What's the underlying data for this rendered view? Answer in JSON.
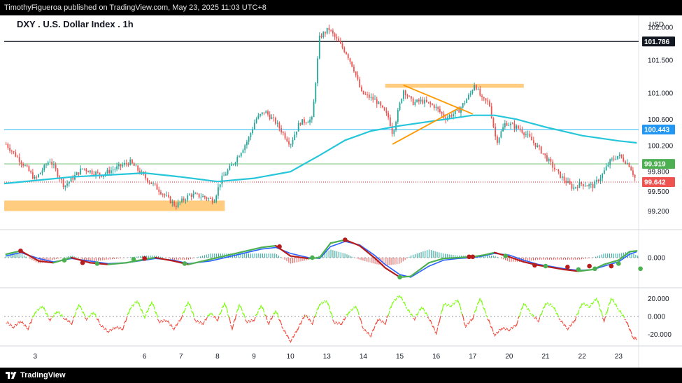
{
  "header": {
    "publisher_text": "TimothyFigueroa published on TradingView.com, May 23, 2025 11:03 UTC+8"
  },
  "chart": {
    "title": "DXY . U.S. Dollar Index . 1h",
    "currency": "USD"
  },
  "footer": {
    "brand": "TradingView"
  },
  "colors": {
    "up": "#26a69a",
    "down": "#ef5350",
    "ema": "#26c6da",
    "black_line": "#131722",
    "blue_line": "#4fc3f7",
    "green_line": "#81c784",
    "red_dotted": "#ef5350",
    "orange_box": "#ffcc80",
    "orange_line": "#ff9800",
    "macd_blue": "#2962ff",
    "macd_signal": "#b71c1c",
    "macd_fast": "#4caf50",
    "rsi_green": "#76ff03",
    "rsi_red": "#f44336"
  },
  "chart_data": {
    "type": "candlestick",
    "symbol": "DXY",
    "name": "U.S. Dollar Index",
    "interval": "1h",
    "x_ticks": [
      "3",
      "6",
      "7",
      "8",
      "9",
      "10",
      "13",
      "14",
      "15",
      "16",
      "17",
      "20",
      "21",
      "22",
      "23"
    ],
    "x_tick_pos": [
      3,
      6,
      7,
      8,
      9,
      10,
      11,
      12,
      13,
      14,
      15,
      16,
      17,
      18,
      19
    ],
    "x_range": [
      2.15,
      19.55
    ],
    "y_ticks": [
      102.0,
      101.5,
      101.0,
      100.6,
      100.2,
      99.8,
      99.5,
      99.2
    ],
    "y_tick_labels": [
      "102.000",
      "101.500",
      "101.000",
      "100.600",
      "100.200",
      "99.800",
      "99.500",
      "99.200"
    ],
    "ylim": [
      98.98,
      102.12
    ],
    "price_labels": [
      {
        "value": 101.786,
        "label": "101.786",
        "color": "#131722"
      },
      {
        "value": 100.443,
        "label": "100.443",
        "color": "#2196f3"
      },
      {
        "value": 99.919,
        "label": "99.919",
        "color": "#4caf50"
      },
      {
        "value": 99.642,
        "label": "99.642",
        "color": "#ef5350"
      }
    ],
    "horizontal_lines": [
      {
        "value": 101.786,
        "color": "#131722",
        "style": "solid"
      },
      {
        "value": 100.443,
        "color": "#4fc3f7",
        "style": "solid"
      },
      {
        "value": 99.919,
        "color": "#81c784",
        "style": "solid"
      },
      {
        "value": 99.642,
        "color": "#ef5350",
        "style": "dotted"
      }
    ],
    "zones": [
      {
        "x": [
          2.15,
          8.2
        ],
        "y": [
          99.2,
          99.36
        ],
        "color": "#ffcc80"
      },
      {
        "x": [
          12.6,
          16.4
        ],
        "y": [
          101.08,
          101.14
        ],
        "color": "#ffcc80"
      }
    ],
    "trendlines": [
      {
        "points": [
          [
            13.1,
            101.12
          ],
          [
            15.0,
            100.68
          ]
        ],
        "color": "#ff9800"
      },
      {
        "points": [
          [
            12.8,
            100.22
          ],
          [
            14.65,
            100.78
          ]
        ],
        "color": "#ff9800"
      }
    ],
    "price_path": [
      [
        2.2,
        100.22
      ],
      [
        2.7,
        99.9
      ],
      [
        3.0,
        99.68
      ],
      [
        3.4,
        99.98
      ],
      [
        3.8,
        99.58
      ],
      [
        4.3,
        99.85
      ],
      [
        4.8,
        99.75
      ],
      [
        5.6,
        99.95
      ],
      [
        6.0,
        99.72
      ],
      [
        6.4,
        99.52
      ],
      [
        6.85,
        99.28
      ],
      [
        7.25,
        99.45
      ],
      [
        7.6,
        99.42
      ],
      [
        7.9,
        99.36
      ],
      [
        8.1,
        99.68
      ],
      [
        8.5,
        99.98
      ],
      [
        8.85,
        100.3
      ],
      [
        9.05,
        100.6
      ],
      [
        9.3,
        100.72
      ],
      [
        9.6,
        100.55
      ],
      [
        10.0,
        100.22
      ],
      [
        10.25,
        100.55
      ],
      [
        10.6,
        100.6
      ],
      [
        10.8,
        101.85
      ],
      [
        11.05,
        101.98
      ],
      [
        11.35,
        101.75
      ],
      [
        11.55,
        101.6
      ],
      [
        11.75,
        101.35
      ],
      [
        11.95,
        101.0
      ],
      [
        12.35,
        100.88
      ],
      [
        12.7,
        100.62
      ],
      [
        12.8,
        100.38
      ],
      [
        13.1,
        101.05
      ],
      [
        13.35,
        100.85
      ],
      [
        13.6,
        100.88
      ],
      [
        13.95,
        100.8
      ],
      [
        14.25,
        100.62
      ],
      [
        14.6,
        100.72
      ],
      [
        14.95,
        101.0
      ],
      [
        15.05,
        101.15
      ],
      [
        15.25,
        100.9
      ],
      [
        15.45,
        100.85
      ],
      [
        15.65,
        100.25
      ],
      [
        15.9,
        100.55
      ],
      [
        16.3,
        100.45
      ],
      [
        16.5,
        100.35
      ],
      [
        16.9,
        100.1
      ],
      [
        17.3,
        99.8
      ],
      [
        17.5,
        99.68
      ],
      [
        17.75,
        99.55
      ],
      [
        17.95,
        99.62
      ],
      [
        18.3,
        99.58
      ],
      [
        18.55,
        99.75
      ],
      [
        18.75,
        99.95
      ],
      [
        19.0,
        100.05
      ],
      [
        19.3,
        99.9
      ],
      [
        19.5,
        99.64
      ]
    ],
    "ema_line": [
      [
        2.15,
        99.62
      ],
      [
        4.0,
        99.72
      ],
      [
        6.0,
        99.78
      ],
      [
        7.0,
        99.72
      ],
      [
        8.0,
        99.65
      ],
      [
        9.0,
        99.7
      ],
      [
        10.0,
        99.8
      ],
      [
        10.8,
        100.05
      ],
      [
        11.5,
        100.28
      ],
      [
        12.2,
        100.42
      ],
      [
        13.0,
        100.5
      ],
      [
        14.0,
        100.58
      ],
      [
        15.0,
        100.66
      ],
      [
        15.6,
        100.66
      ],
      [
        16.2,
        100.6
      ],
      [
        17.0,
        100.48
      ],
      [
        18.0,
        100.35
      ],
      [
        19.0,
        100.27
      ],
      [
        19.5,
        100.24
      ]
    ],
    "macd": {
      "zero_label": "0.000",
      "ylim": [
        -0.33,
        0.28
      ],
      "fast": [
        [
          2.2,
          0.04
        ],
        [
          2.6,
          0.08
        ],
        [
          3.1,
          -0.04
        ],
        [
          3.5,
          -0.06
        ],
        [
          4.0,
          0.0
        ],
        [
          4.5,
          -0.06
        ],
        [
          5.0,
          -0.08
        ],
        [
          5.5,
          -0.06
        ],
        [
          6.0,
          -0.02
        ],
        [
          6.3,
          0.0
        ],
        [
          6.8,
          -0.04
        ],
        [
          7.2,
          -0.08
        ],
        [
          7.8,
          -0.02
        ],
        [
          8.3,
          0.03
        ],
        [
          8.8,
          0.08
        ],
        [
          9.2,
          0.12
        ],
        [
          9.6,
          0.14
        ],
        [
          10.0,
          0.02
        ],
        [
          10.5,
          -0.01
        ],
        [
          10.8,
          0.0
        ],
        [
          11.1,
          0.17
        ],
        [
          11.5,
          0.21
        ],
        [
          11.9,
          0.14
        ],
        [
          12.3,
          0.0
        ],
        [
          12.6,
          -0.12
        ],
        [
          13.0,
          -0.23
        ],
        [
          13.3,
          -0.22
        ],
        [
          13.8,
          -0.06
        ],
        [
          14.2,
          -0.01
        ],
        [
          14.6,
          0.0
        ],
        [
          15.0,
          0.01
        ],
        [
          15.3,
          0.03
        ],
        [
          15.6,
          0.06
        ],
        [
          16.0,
          0.01
        ],
        [
          16.4,
          -0.05
        ],
        [
          16.8,
          -0.09
        ],
        [
          17.1,
          -0.11
        ],
        [
          17.5,
          -0.14
        ],
        [
          17.9,
          -0.16
        ],
        [
          18.3,
          -0.14
        ],
        [
          18.6,
          -0.08
        ],
        [
          19.0,
          -0.03
        ],
        [
          19.3,
          0.07
        ],
        [
          19.5,
          0.08
        ]
      ],
      "slow": [
        [
          2.2,
          0.02
        ],
        [
          2.6,
          0.06
        ],
        [
          3.1,
          -0.01
        ],
        [
          3.5,
          -0.05
        ],
        [
          4.0,
          -0.01
        ],
        [
          4.5,
          -0.04
        ],
        [
          5.0,
          -0.07
        ],
        [
          5.5,
          -0.06
        ],
        [
          6.0,
          -0.03
        ],
        [
          6.3,
          -0.01
        ],
        [
          6.8,
          -0.03
        ],
        [
          7.2,
          -0.07
        ],
        [
          7.8,
          -0.04
        ],
        [
          8.3,
          0.01
        ],
        [
          8.8,
          0.06
        ],
        [
          9.2,
          0.1
        ],
        [
          9.6,
          0.12
        ],
        [
          10.0,
          0.05
        ],
        [
          10.5,
          0.0
        ],
        [
          10.8,
          -0.01
        ],
        [
          11.1,
          0.13
        ],
        [
          11.5,
          0.19
        ],
        [
          11.9,
          0.15
        ],
        [
          12.3,
          0.03
        ],
        [
          12.6,
          -0.08
        ],
        [
          13.0,
          -0.2
        ],
        [
          13.3,
          -0.23
        ],
        [
          13.8,
          -0.1
        ],
        [
          14.2,
          -0.03
        ],
        [
          14.6,
          -0.01
        ],
        [
          15.0,
          0.0
        ],
        [
          15.3,
          0.02
        ],
        [
          15.6,
          0.05
        ],
        [
          16.0,
          0.03
        ],
        [
          16.4,
          -0.03
        ],
        [
          16.8,
          -0.08
        ],
        [
          17.1,
          -0.1
        ],
        [
          17.5,
          -0.13
        ],
        [
          17.9,
          -0.15
        ],
        [
          18.3,
          -0.14
        ],
        [
          18.6,
          -0.1
        ],
        [
          19.0,
          -0.05
        ],
        [
          19.3,
          0.04
        ],
        [
          19.5,
          0.07
        ]
      ],
      "signal_dots": [
        {
          "x": 2.6,
          "v": 0.08,
          "c": "#b71c1c"
        },
        {
          "x": 3.8,
          "v": -0.03,
          "c": "#4caf50"
        },
        {
          "x": 4.3,
          "v": -0.06,
          "c": "#b71c1c"
        },
        {
          "x": 4.7,
          "v": -0.07,
          "c": "#4caf50"
        },
        {
          "x": 5.7,
          "v": -0.02,
          "c": "#4caf50"
        },
        {
          "x": 6.0,
          "v": -0.01,
          "c": "#b71c1c"
        },
        {
          "x": 7.1,
          "v": -0.07,
          "c": "#4caf50"
        },
        {
          "x": 9.7,
          "v": 0.13,
          "c": "#b71c1c"
        },
        {
          "x": 10.6,
          "v": 0.0,
          "c": "#4caf50"
        },
        {
          "x": 11.5,
          "v": 0.21,
          "c": "#b71c1c"
        },
        {
          "x": 13.0,
          "v": -0.23,
          "c": "#4caf50"
        },
        {
          "x": 14.9,
          "v": 0.01,
          "c": "#b71c1c"
        },
        {
          "x": 15.0,
          "v": 0.01,
          "c": "#b71c1c"
        },
        {
          "x": 15.9,
          "v": 0.02,
          "c": "#4caf50"
        },
        {
          "x": 16.7,
          "v": -0.09,
          "c": "#b71c1c"
        },
        {
          "x": 17.0,
          "v": -0.1,
          "c": "#4caf50"
        },
        {
          "x": 17.6,
          "v": -0.11,
          "c": "#b71c1c"
        },
        {
          "x": 17.9,
          "v": -0.14,
          "c": "#4caf50"
        },
        {
          "x": 18.2,
          "v": -0.1,
          "c": "#b71c1c"
        },
        {
          "x": 18.35,
          "v": -0.13,
          "c": "#4caf50"
        },
        {
          "x": 18.8,
          "v": -0.1,
          "c": "#b71c1c"
        },
        {
          "x": 19.0,
          "v": -0.07,
          "c": "#4caf50"
        },
        {
          "x": 19.6,
          "v": -0.13,
          "c": "#4caf50"
        }
      ]
    },
    "oscillator": {
      "ylim": [
        -30,
        30
      ],
      "ticks": [
        20.0,
        0.0,
        -20.0
      ],
      "tick_labels": [
        "20.000",
        "0.000",
        "-20.000"
      ],
      "values": [
        [
          2.2,
          -6
        ],
        [
          2.4,
          -12
        ],
        [
          2.6,
          -5
        ],
        [
          2.8,
          -14
        ],
        [
          3.0,
          5
        ],
        [
          3.2,
          12
        ],
        [
          3.4,
          -4
        ],
        [
          3.6,
          6
        ],
        [
          3.8,
          -2
        ],
        [
          4.0,
          -8
        ],
        [
          4.2,
          14
        ],
        [
          4.4,
          -3
        ],
        [
          4.6,
          5
        ],
        [
          4.8,
          -10
        ],
        [
          5.0,
          -17
        ],
        [
          5.2,
          -12
        ],
        [
          5.4,
          -14
        ],
        [
          5.6,
          9
        ],
        [
          5.8,
          18
        ],
        [
          6.0,
          -1
        ],
        [
          6.2,
          17
        ],
        [
          6.4,
          -6
        ],
        [
          6.6,
          -4
        ],
        [
          6.8,
          -14
        ],
        [
          7.0,
          -2
        ],
        [
          7.2,
          17
        ],
        [
          7.4,
          -5
        ],
        [
          7.6,
          -8
        ],
        [
          7.8,
          4
        ],
        [
          8.0,
          -4
        ],
        [
          8.2,
          16
        ],
        [
          8.4,
          -14
        ],
        [
          8.6,
          14
        ],
        [
          8.8,
          -6
        ],
        [
          9.0,
          -4
        ],
        [
          9.2,
          13
        ],
        [
          9.4,
          -8
        ],
        [
          9.6,
          7
        ],
        [
          9.8,
          -14
        ],
        [
          10.0,
          -28
        ],
        [
          10.2,
          -14
        ],
        [
          10.4,
          2
        ],
        [
          10.6,
          -8
        ],
        [
          10.8,
          14
        ],
        [
          11.0,
          18
        ],
        [
          11.2,
          -7
        ],
        [
          11.4,
          -8
        ],
        [
          11.6,
          5
        ],
        [
          11.8,
          12
        ],
        [
          12.0,
          -14
        ],
        [
          12.2,
          -22
        ],
        [
          12.4,
          -3
        ],
        [
          12.6,
          -8
        ],
        [
          12.8,
          16
        ],
        [
          13.0,
          24
        ],
        [
          13.2,
          9
        ],
        [
          13.4,
          -3
        ],
        [
          13.6,
          11
        ],
        [
          13.8,
          -2
        ],
        [
          14.0,
          -19
        ],
        [
          14.2,
          14
        ],
        [
          14.4,
          12
        ],
        [
          14.6,
          19
        ],
        [
          14.8,
          -11
        ],
        [
          15.0,
          -2
        ],
        [
          15.2,
          21
        ],
        [
          15.4,
          -1
        ],
        [
          15.6,
          -21
        ],
        [
          15.8,
          -13
        ],
        [
          16.0,
          -15
        ],
        [
          16.2,
          -9
        ],
        [
          16.4,
          15
        ],
        [
          16.6,
          3
        ],
        [
          16.8,
          -5
        ],
        [
          17.0,
          15
        ],
        [
          17.2,
          12
        ],
        [
          17.4,
          -4
        ],
        [
          17.6,
          -14
        ],
        [
          17.8,
          -4
        ],
        [
          18.0,
          15
        ],
        [
          18.2,
          11
        ],
        [
          18.4,
          21
        ],
        [
          18.6,
          -5
        ],
        [
          18.8,
          21
        ],
        [
          19.0,
          8
        ],
        [
          19.2,
          -4
        ],
        [
          19.4,
          -24
        ],
        [
          19.5,
          -25
        ]
      ]
    }
  }
}
